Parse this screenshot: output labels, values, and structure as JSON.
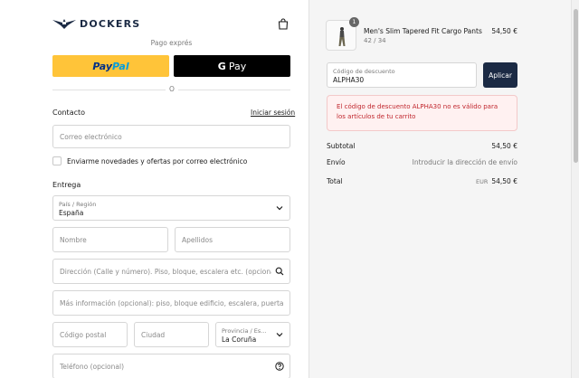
{
  "header": {
    "brand": "DOCKERS"
  },
  "express": {
    "label": "Pago exprés",
    "paypal_part1": "Pay",
    "paypal_part2": "Pal",
    "gpay_g": "G",
    "gpay_label": "Pay",
    "divider_label": "O"
  },
  "contact": {
    "title": "Contacto",
    "login_link": "Iniciar sesión",
    "email_placeholder": "Correo electrónico",
    "newsletter_label": "Enviarme novedades y ofertas por correo electrónico"
  },
  "delivery": {
    "title": "Entrega",
    "country_label": "País / Región",
    "country_value": "España",
    "first_name_placeholder": "Nombre",
    "last_name_placeholder": "Apellidos",
    "address_placeholder": "Dirección (Calle y número). Piso, bloque, escalera etc. (opcional)",
    "address2_placeholder": "Más información (opcional): piso, bloque edificio, escalera, puerta etc.",
    "postal_placeholder": "Código postal",
    "city_placeholder": "Ciudad",
    "province_label": "Provincia / Es...",
    "province_value": "La Coruña",
    "phone_placeholder": "Teléfono (opcional)"
  },
  "cart": {
    "quantity": "1",
    "product_name": "Men's Slim Tapered Fit Cargo Pants",
    "product_variant": "42 / 34",
    "product_price": "54,50 €"
  },
  "discount": {
    "label": "Código de descuento",
    "value": "ALPHA30",
    "apply_label": "Aplicar",
    "error": "El código de descuento ALPHA30 no es válido para los artículos de tu carrito"
  },
  "summary": {
    "subtotal_label": "Subtotal",
    "subtotal_value": "54,50 €",
    "shipping_label": "Envío",
    "shipping_value": "Introducir la dirección de envío",
    "total_label": "Total",
    "total_currency": "EUR",
    "total_value": "54,50 €"
  },
  "colors": {
    "brand_navy": "#1b2a44",
    "paypal_yellow": "#ffc439",
    "error_red": "#c0262d"
  }
}
